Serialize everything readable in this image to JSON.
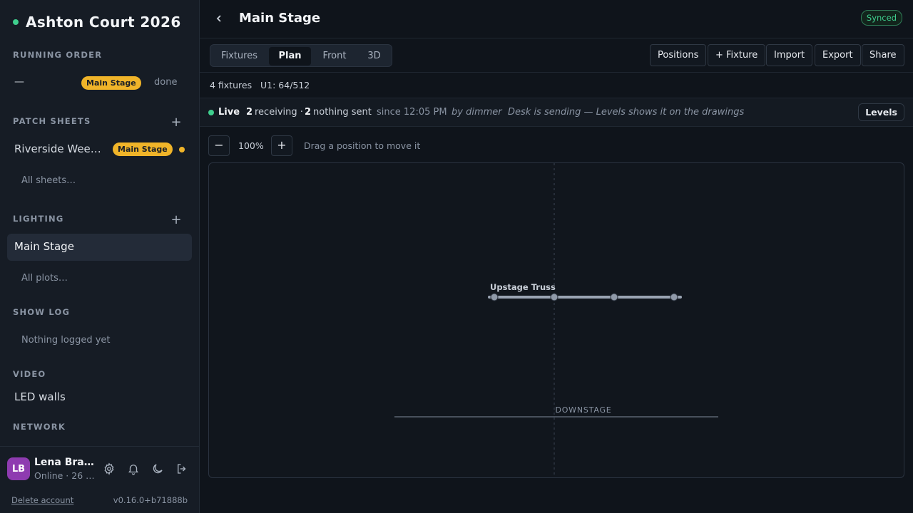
{
  "sidebar": {
    "project_title": "Ashton Court 2026",
    "running_order": {
      "heading": "RUNNING ORDER",
      "row": {
        "dash": "—",
        "badge": "Main Stage",
        "status": "done"
      }
    },
    "patch_sheets": {
      "heading": "PATCH SHEETS",
      "add": "+",
      "row": {
        "name": "Riverside Weekender",
        "badge": "Main Stage"
      },
      "all_link": "All sheets…"
    },
    "lighting": {
      "heading": "LIGHTING",
      "add": "+",
      "active_item": "Main Stage",
      "all_link": "All plots…"
    },
    "show_log": {
      "heading": "SHOW LOG",
      "empty": "Nothing logged yet"
    },
    "video": {
      "heading": "VIDEO",
      "item": "LED walls"
    },
    "network": {
      "heading": "NETWORK"
    },
    "user": {
      "initials": "LB",
      "name": "Lena Bradshaw",
      "status": "Online · 26 …"
    },
    "delete_account": "Delete account",
    "version": "v0.16.0+b71888b"
  },
  "header": {
    "back": "‹",
    "title": "Main Stage",
    "sync_status": "Synced"
  },
  "toolbar": {
    "tabs": [
      "Fixtures",
      "Plan",
      "Front",
      "3D"
    ],
    "active_tab": "Plan",
    "buttons": [
      "Positions",
      "+ Fixture",
      "Import",
      "Export",
      "Share"
    ]
  },
  "counts": {
    "fixtures": "4 fixtures",
    "universe": "U1: 64/512"
  },
  "live": {
    "label": "Live",
    "receiving_count": "2",
    "receiving_label": "receiving ·",
    "nothing_count": "2",
    "nothing_label": "nothing sent",
    "since": "since 12:05 PM",
    "by": "by dimmer",
    "note": "Desk is sending — Levels shows it on the drawings",
    "levels_button": "Levels"
  },
  "zoom": {
    "minus": "−",
    "value": "100%",
    "plus": "+",
    "hint": "Drag a position to move it"
  },
  "plan": {
    "position_label": "Upstage Truss",
    "fixture_count": 4,
    "downstage_label": "DOWNSTAGE"
  },
  "colors": {
    "accent_green": "#3fcf8e",
    "badge_amber": "#f0b429",
    "avatar_purple": "#8e3bb0",
    "truss": "#9aa4b3"
  }
}
